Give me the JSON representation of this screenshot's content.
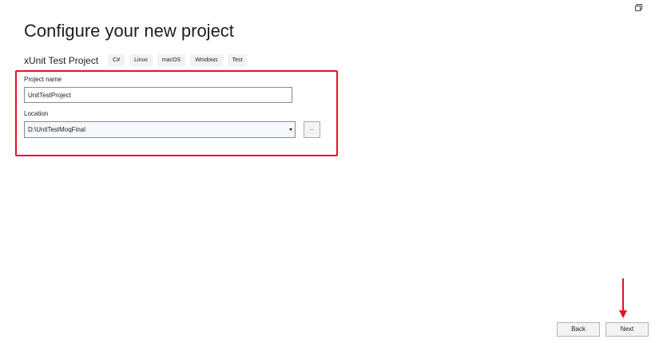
{
  "header": {
    "title": "Configure your new project"
  },
  "template": {
    "name": "xUnit Test Project",
    "tags": [
      "C#",
      "Linux",
      "macOS",
      "Windows",
      "Test"
    ]
  },
  "form": {
    "project_name_label": "Project name",
    "project_name_value": "UnitTestProject",
    "location_label": "Location",
    "location_value": "D:\\UnitTestMoqFinal",
    "browse_label": "..."
  },
  "footer": {
    "back_label": "Back",
    "next_label": "Next"
  },
  "colors": {
    "highlight": "#e81123",
    "accent": "#e81123"
  },
  "icons": {
    "window_control": "restore-icon",
    "dropdown": "chevron-down-icon",
    "annotation": "arrow-down-icon"
  }
}
